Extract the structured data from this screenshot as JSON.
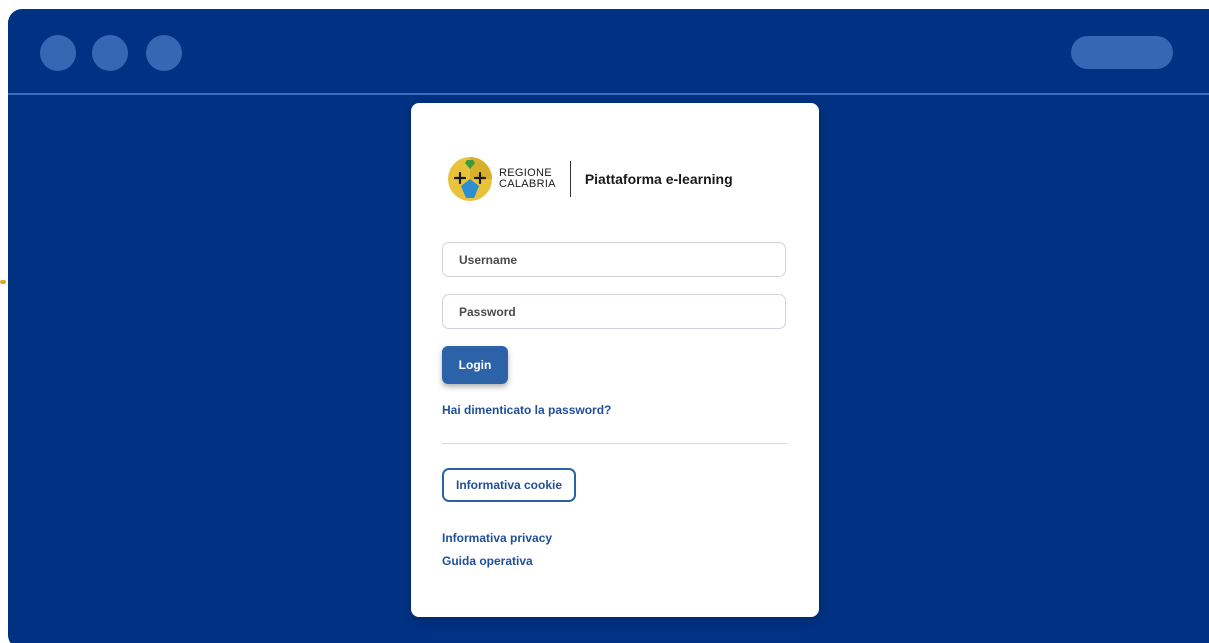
{
  "window": {
    "titlebar_dots": 3,
    "accent_color": "#003283",
    "control_color": "#3567b4"
  },
  "brand": {
    "region_line1": "REGIONE",
    "region_line2": "CALABRIA",
    "platform_name": "Piattaforma e-learning",
    "logo_icon": "regione-calabria-crest-icon"
  },
  "login_form": {
    "username_placeholder": "Username",
    "password_placeholder": "Password",
    "login_label": "Login",
    "forgot_password": "Hai dimenticato la password?"
  },
  "footer_links": {
    "cookie_label": "Informativa cookie",
    "privacy_label": "Informativa privacy",
    "guide_label": "Guida operativa"
  },
  "colors": {
    "primary_button": "#2c63a8",
    "link": "#1f4f99"
  }
}
